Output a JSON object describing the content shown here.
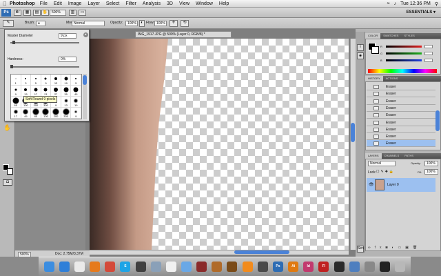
{
  "menubar": {
    "app_name": "Photoshop",
    "menus": [
      "File",
      "Edit",
      "Image",
      "Layer",
      "Select",
      "Filter",
      "Analysis",
      "3D",
      "View",
      "Window",
      "Help"
    ],
    "clock": "Tue 12:36 PM"
  },
  "appbar": {
    "logo": "Ps",
    "zoom": "500%",
    "workspace": "ESSENTIALS ▾"
  },
  "options": {
    "brush_label": "Brush:",
    "mode_label": "Mode:",
    "mode_value": "Normal",
    "opacity_label": "Opacity:",
    "opacity_value": "100%",
    "flow_label": "Flow:",
    "flow_value": "100%"
  },
  "document": {
    "tab_title": "IMG_1917.JPG @ 500% (Layer 0, RGB/8) *",
    "zoom_status": "500%",
    "doc_size": "Doc: 2.75M/3.37M"
  },
  "brush_picker": {
    "master_diameter_label": "Master Diameter",
    "master_diameter_value": "9 px",
    "hardness_label": "Hardness:",
    "hardness_value": "0%",
    "diameter_level": 0.03,
    "hardness_level": 0.0,
    "tooltip": "Soft Round 9 pixels",
    "brush_sizes": [
      "1",
      "3",
      "5",
      "9",
      "13",
      "19",
      "5",
      "9",
      "13",
      "17",
      "21",
      "27",
      "35",
      "45",
      "65",
      "100",
      "200",
      "300",
      "9",
      "13",
      "19",
      "17",
      "45",
      "65",
      "100",
      "200",
      "300",
      "9"
    ]
  },
  "panels": {
    "color_tabs": [
      "COLOR",
      "SWATCHES",
      "STYLES"
    ],
    "color_channels": [
      {
        "label": "R",
        "value": "",
        "color": "#e02020"
      },
      {
        "label": "G",
        "value": "",
        "color": "#20b020"
      },
      {
        "label": "B",
        "value": "",
        "color": "#2040e0"
      }
    ],
    "history_tabs": [
      "HISTORY",
      "ACTIONS"
    ],
    "history_items": [
      "Eraser",
      "Eraser",
      "Eraser",
      "Eraser",
      "Eraser",
      "Eraser",
      "Eraser",
      "Eraser",
      "Eraser"
    ],
    "layers_tabs": [
      "LAYERS",
      "CHANNELS",
      "PATHS"
    ],
    "blend_mode": "Normal",
    "opacity_label": "Opacity:",
    "opacity_value": "100%",
    "lock_label": "Lock:",
    "fill_label": "Fill:",
    "fill_value": "100%",
    "layer_name": "Layer 0"
  },
  "dock": {
    "icons": [
      {
        "name": "finder-icon",
        "label": "",
        "color": "#3b8de0"
      },
      {
        "name": "app-store-icon",
        "label": "",
        "color": "#2f7fd8"
      },
      {
        "name": "clock-icon",
        "label": "",
        "color": "#eaeaea"
      },
      {
        "name": "firefox-icon",
        "label": "",
        "color": "#e67a1c"
      },
      {
        "name": "chrome-icon",
        "label": "",
        "color": "#d44a3a"
      },
      {
        "name": "skype-icon",
        "label": "S",
        "color": "#1ea4e6"
      },
      {
        "name": "dashboard-icon",
        "label": "",
        "color": "#404040"
      },
      {
        "name": "mail-icon",
        "label": "",
        "color": "#8aa0b8"
      },
      {
        "name": "calendar-icon",
        "label": "",
        "color": "#f0f0f0"
      },
      {
        "name": "itunes-icon",
        "label": "",
        "color": "#6aa8e6"
      },
      {
        "name": "photo-booth-icon",
        "label": "",
        "color": "#8a2a2a"
      },
      {
        "name": "guitar-icon",
        "label": "",
        "color": "#b06a28"
      },
      {
        "name": "guitar2-icon",
        "label": "",
        "color": "#7a4b18"
      },
      {
        "name": "vlc-icon",
        "label": "",
        "color": "#f28b1c"
      },
      {
        "name": "preview-icon",
        "label": "",
        "color": "#4a4a4a"
      },
      {
        "name": "photoshop-icon",
        "label": "Ps",
        "color": "#2d6cb4"
      },
      {
        "name": "illustrator-icon",
        "label": "Ai",
        "color": "#e07a10"
      },
      {
        "name": "indesign-icon",
        "label": "Id",
        "color": "#c23a6e"
      },
      {
        "name": "flash-icon",
        "label": "Fl",
        "color": "#c02020"
      },
      {
        "name": "app-icon",
        "label": "",
        "color": "#2a2a2a"
      },
      {
        "name": "mission-control-icon",
        "label": "",
        "color": "#4e7fbf"
      },
      {
        "name": "system-prefs-icon",
        "label": "",
        "color": "#888888"
      },
      {
        "name": "terminal-icon",
        "label": "",
        "color": "#222222"
      },
      {
        "name": "trash-icon",
        "label": "",
        "color": "#b8b8b8"
      }
    ]
  }
}
